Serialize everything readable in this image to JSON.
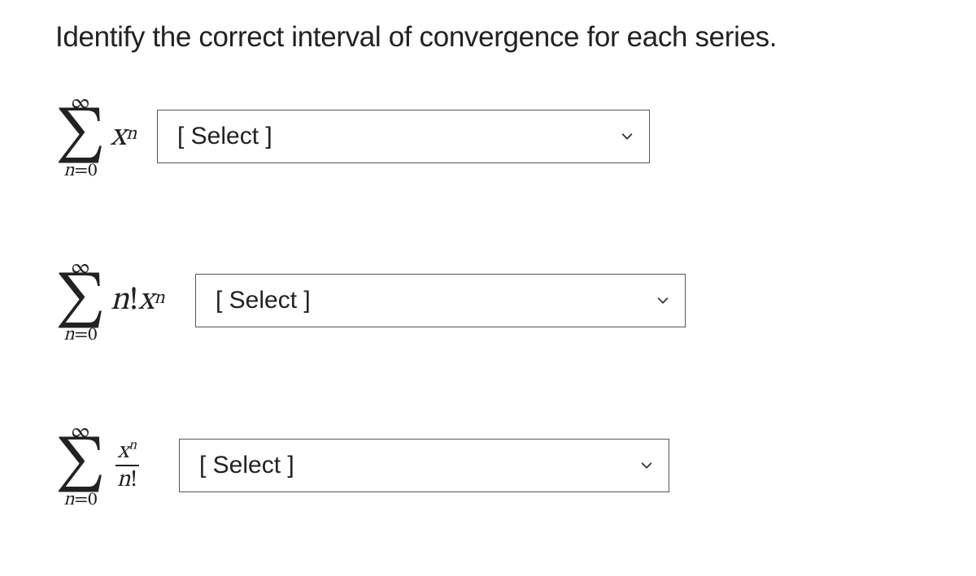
{
  "prompt": "Identify the correct interval of convergence for each series.",
  "select_placeholder": "[ Select ]",
  "series": [
    {
      "id": "sum-x-n",
      "top": "∞",
      "bottom_var": "n",
      "bottom_eq": "=",
      "bottom_val": "0",
      "term_html": "x^n"
    },
    {
      "id": "sum-n-fact-x-n",
      "top": "∞",
      "bottom_var": "n",
      "bottom_eq": "=",
      "bottom_val": "0",
      "term_html": "n!x^n"
    },
    {
      "id": "sum-x-n-over-n-fact",
      "top": "∞",
      "bottom_var": "n",
      "bottom_eq": "=",
      "bottom_val": "0",
      "term_html": "x^n / n!"
    }
  ]
}
